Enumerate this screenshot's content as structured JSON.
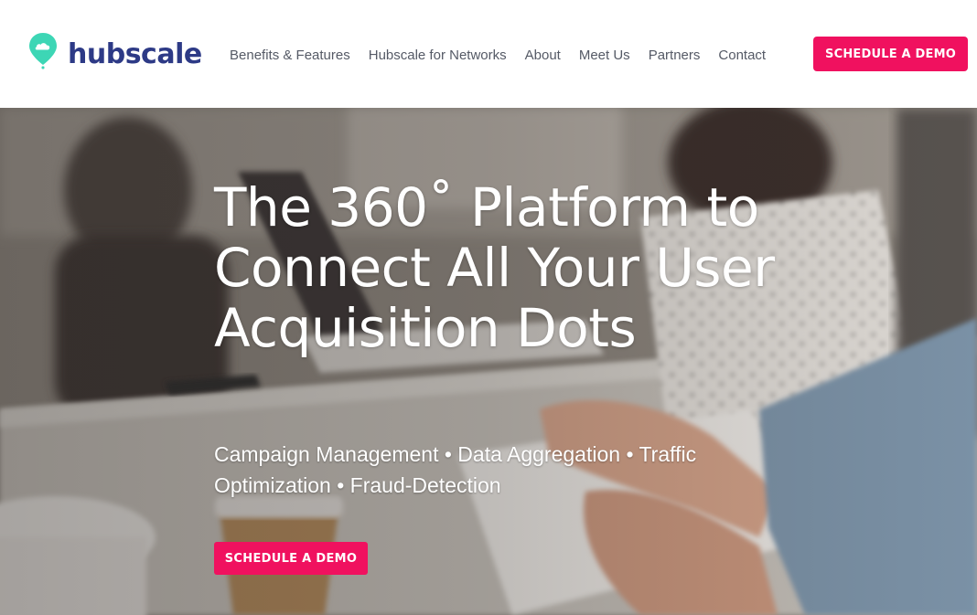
{
  "brand": {
    "name": "hubscale",
    "logo_color": "#2d3a86",
    "pin_color": "#3dd6b5",
    "accent": "#f0115f"
  },
  "nav": {
    "items": [
      {
        "label": "Benefits & Features"
      },
      {
        "label": "Hubscale for Networks"
      },
      {
        "label": "About"
      },
      {
        "label": "Meet Us"
      },
      {
        "label": "Partners"
      },
      {
        "label": "Contact"
      }
    ],
    "cta_label": "SCHEDULE A DEMO"
  },
  "hero": {
    "title": "The 360˚ Platform to Connect All Your User Acquisition Dots",
    "subtitle": "Campaign Management • Data Aggregation • Traffic Optimization • Fraud-Detection",
    "cta_label": "SCHEDULE A DEMO"
  }
}
